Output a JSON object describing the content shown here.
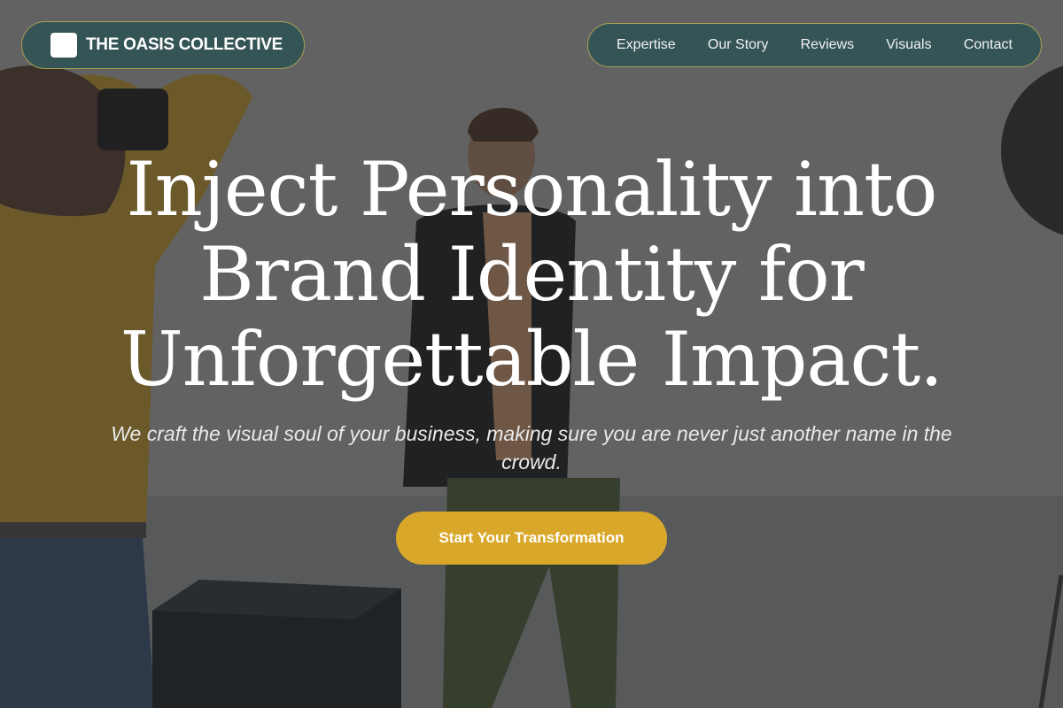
{
  "header": {
    "brand_name": "THE OASIS COLLECTIVE",
    "nav": [
      {
        "label": "Expertise"
      },
      {
        "label": "Our Story"
      },
      {
        "label": "Reviews"
      },
      {
        "label": "Visuals"
      },
      {
        "label": "Contact"
      }
    ]
  },
  "hero": {
    "headline": "Inject Personality into Brand Identity for Unforgettable Impact.",
    "subheadline": "We craft the visual soul of your business, making sure you are never just another name in the crowd.",
    "cta_label": "Start Your Transformation"
  },
  "colors": {
    "pill_background": "#355455",
    "pill_border": "#a8a055",
    "cta_background": "#d9a82a",
    "text": "#ffffff"
  }
}
